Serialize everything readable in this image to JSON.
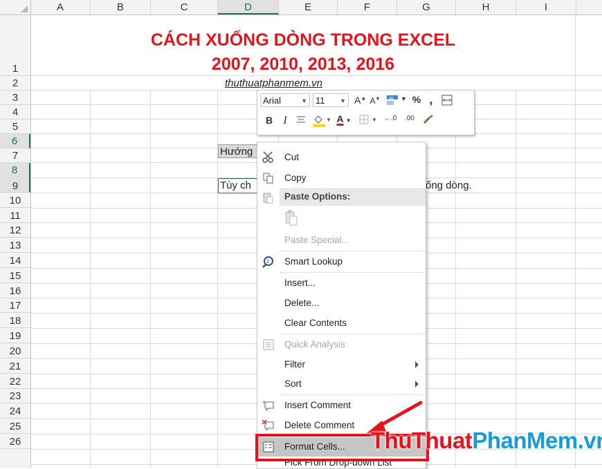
{
  "columns": [
    "A",
    "B",
    "C",
    "D",
    "E",
    "F",
    "G",
    "H",
    "I"
  ],
  "rows": [
    "1",
    "2",
    "3",
    "4",
    "5",
    "6",
    "7",
    "8",
    "9",
    "10",
    "11",
    "12",
    "13",
    "14",
    "15",
    "16",
    "17",
    "18",
    "19",
    "20",
    "21",
    "22",
    "23",
    "24",
    "25",
    "26"
  ],
  "title_line1": "CÁCH XUỐNG DÒNG TRONG EXCEL",
  "title_line2": "2007, 2010, 2013, 2016",
  "cells": {
    "row2": "thuthuatphanmem.vn",
    "row6": "Hướng",
    "row8_left": "Tùy ch",
    "row8_right": "ống dòng."
  },
  "mini_toolbar": {
    "font": "Arial",
    "size": "11",
    "grow_font": "A",
    "shrink_font": "A",
    "percent": "%",
    "comma": ",",
    "bold": "B",
    "italic": "I",
    "font_color": "A",
    "inc_decimal": "←.0",
    "dec_decimal": ".00"
  },
  "menu": {
    "cut": "Cut",
    "copy": "Copy",
    "paste_options": "Paste Options:",
    "paste_special": "Paste Special...",
    "smart_lookup": "Smart Lookup",
    "insert": "Insert...",
    "delete": "Delete...",
    "clear_contents": "Clear Contents",
    "quick_analysis": "Quick Analysis",
    "filter": "Filter",
    "sort": "Sort",
    "insert_comment": "Insert Comment",
    "delete_comment": "Delete Comment",
    "format_cells": "Format Cells...",
    "pick_from_list": "Pick From Drop-down List"
  },
  "watermark": {
    "part1": "Thu",
    "part2": "Thuat",
    "part3": "PhanMem",
    "part4": ".vn"
  },
  "colors": {
    "accent_green": "#217346",
    "title_red": "#e3141b",
    "highlight_red": "#e3141b",
    "watermark_blue": "#1a9ad6"
  }
}
